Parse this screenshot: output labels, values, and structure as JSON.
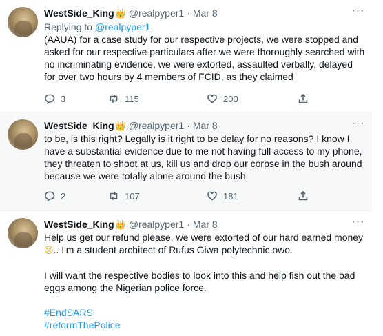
{
  "tweets": [
    {
      "author_name": "WestSide_King",
      "crown_icon": "crown-emoji",
      "handle": "@realpyper1",
      "separator": "·",
      "date": "Mar 8",
      "replying_prefix": "Replying to ",
      "replying_to": "@realpyper1",
      "text": "(AAUA) for a case study for our respective projects, we were stopped and asked for our respective particulars after we were thoroughly searched with no incriminating evidence, we were extorted, assaulted verbally, delayed for over two hours by 4 members of FCID, as they claimed",
      "replies": "3",
      "retweets": "115",
      "likes": "200"
    },
    {
      "author_name": "WestSide_King",
      "crown_icon": "crown-emoji",
      "handle": "@realpyper1",
      "separator": "·",
      "date": "Mar 8",
      "text": "to be, is this right? Legally is it right to be delay for no reasons? I know I have a substantial evidence due to me not having full access to my phone, they threaten to shoot at us, kill us and drop our corpse in the bush around because we were totally alone around the bush.",
      "replies": "2",
      "retweets": "107",
      "likes": "181"
    },
    {
      "author_name": "WestSide_King",
      "crown_icon": "crown-emoji",
      "handle": "@realpyper1",
      "separator": "·",
      "date": "Mar 8",
      "text_line1": "Help us get our refund please, we were extorted of our hard earned money",
      "emoji": "😢",
      "text_line2": ".. I'm a student architect of Rufus Giwa polytechnic owo.",
      "paragraph2": "I will want the respective bodies to look into this and help fish out the bad eggs among the Nigerian police force.",
      "hashtags": [
        "#EndSARS",
        "#reformThePolice"
      ]
    }
  ],
  "colors": {
    "accent": "#1d9bf0",
    "secondary_text": "#536471",
    "hover_bg": "#f7f9f9",
    "divider": "#eff3f4"
  }
}
